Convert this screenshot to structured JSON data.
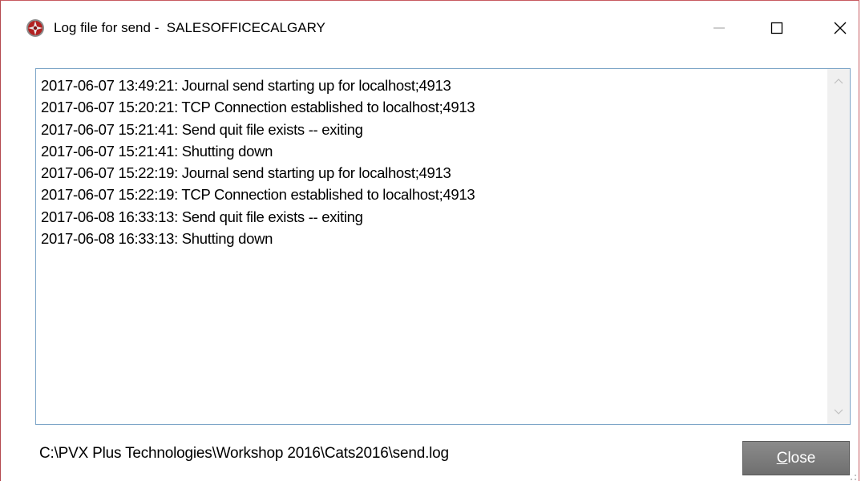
{
  "window": {
    "title": "Log file for send -  SALESOFFICECALGARY",
    "app_icon": "app-logo-icon",
    "controls": {
      "minimize": "minimize-icon",
      "maximize": "maximize-icon",
      "close": "close-icon"
    }
  },
  "log": {
    "lines": [
      "2017-06-07 13:49:21: Journal send starting up for localhost;4913",
      "2017-06-07 15:20:21: TCP Connection established to localhost;4913",
      "2017-06-07 15:21:41: Send quit file exists -- exiting",
      "2017-06-07 15:21:41: Shutting down",
      "2017-06-07 15:22:19: Journal send starting up for localhost;4913",
      "2017-06-07 15:22:19: TCP Connection established to localhost;4913",
      "2017-06-08 16:33:13: Send quit file exists -- exiting",
      "2017-06-08 16:33:13: Shutting down"
    ]
  },
  "footer": {
    "file_path": "C:\\PVX Plus Technologies\\Workshop 2016\\Cats2016\\send.log",
    "close_button": {
      "mnemonic": "C",
      "rest": "lose"
    }
  },
  "colors": {
    "window_border": "#c85a60",
    "log_border": "#7ea6c8",
    "button_bg": "#7d7d7d",
    "scrollbar_bg": "#f0f0f0"
  }
}
